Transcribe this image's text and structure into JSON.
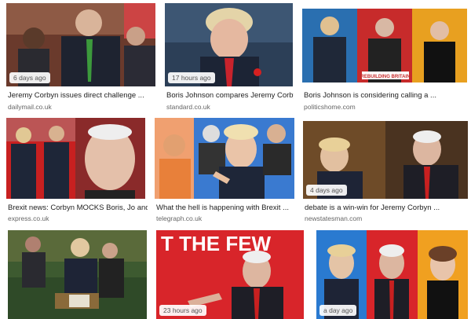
{
  "results": [
    {
      "title": "Jeremy Corbyn issues direct challenge ...",
      "source": "dailymail.co.uk",
      "age": "6 days ago"
    },
    {
      "title": "Boris Johnson compares Jeremy Corbyn t...",
      "source": "standard.co.uk",
      "age": "17 hours ago"
    },
    {
      "title": "Boris Johnson is considering calling a ...",
      "source": "politicshome.com",
      "age": "",
      "banner": "REBUILDING BRITAIN"
    },
    {
      "title": "Brexit news: Corbyn MOCKS Boris, Jo and ...",
      "source": "express.co.uk",
      "age": ""
    },
    {
      "title": "What the hell is happening with Brexit ...",
      "source": "telegraph.co.uk",
      "age": ""
    },
    {
      "title": "debate is a win-win for Jeremy Corbyn ...",
      "source": "newstatesman.com",
      "age": "4 days ago"
    },
    {
      "title": "",
      "source": "",
      "age": ""
    },
    {
      "title": "",
      "source": "",
      "age": "23 hours ago",
      "banner": "T THE FEW"
    },
    {
      "title": "",
      "source": "",
      "age": "a day ago"
    }
  ]
}
